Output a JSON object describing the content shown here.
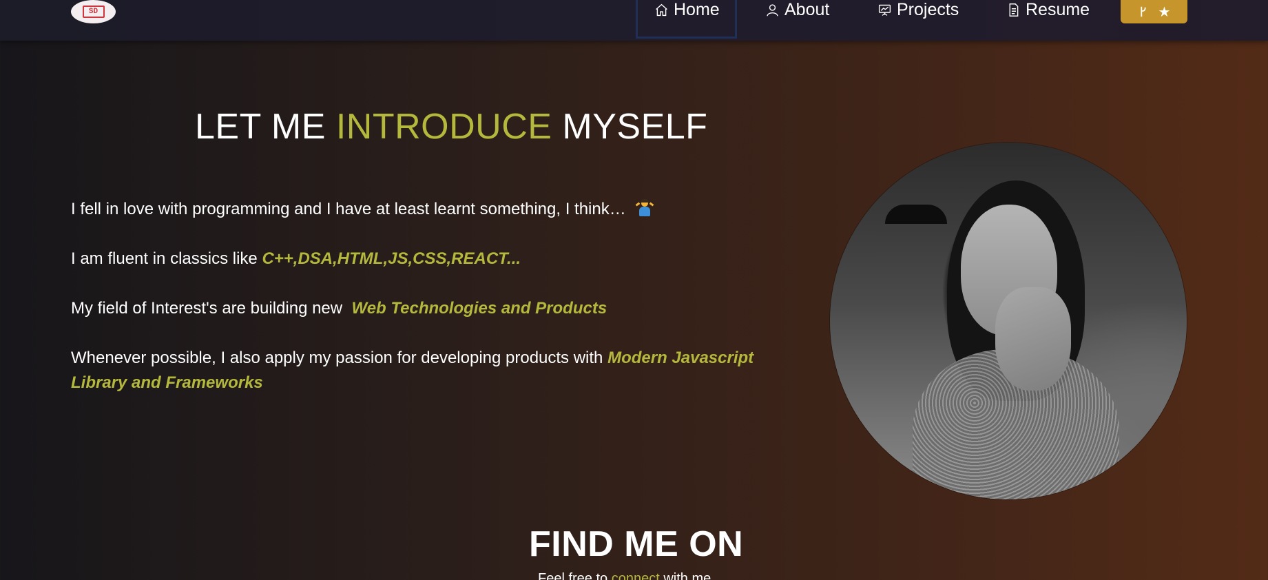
{
  "logo": {
    "mark_text": "SD"
  },
  "nav": {
    "home": "Home",
    "about": "About",
    "projects": "Projects",
    "resume": "Resume"
  },
  "about": {
    "heading_part1": "LET ME",
    "heading_accent": "INTRODUCE",
    "heading_part2": "MYSELF",
    "p1": "I fell in love with programming and I have at least learnt something, I think…",
    "p2_text": "I am fluent in classics like",
    "p2_highlight": "C++,DSA,HTML,JS,CSS,REACT...",
    "p3_text": "My field of Interest's are building new",
    "p3_highlight": "Web Technologies and Products",
    "p4_text": "Whenever possible, I also apply my passion for developing products with",
    "p4_highlight": "Modern Javascript Library and Frameworks"
  },
  "find": {
    "heading": "FIND ME ON",
    "sub_before": "Feel free to",
    "sub_link": "connect",
    "sub_after": "with me"
  },
  "colors": {
    "accent": "#b4b83c",
    "fork_button": "#c6962c",
    "navbar": "#1c1b28"
  },
  "icons": [
    "home-icon",
    "user-icon",
    "presentation-icon",
    "document-icon",
    "git-fork-icon",
    "star-icon",
    "shrug-emoji"
  ]
}
